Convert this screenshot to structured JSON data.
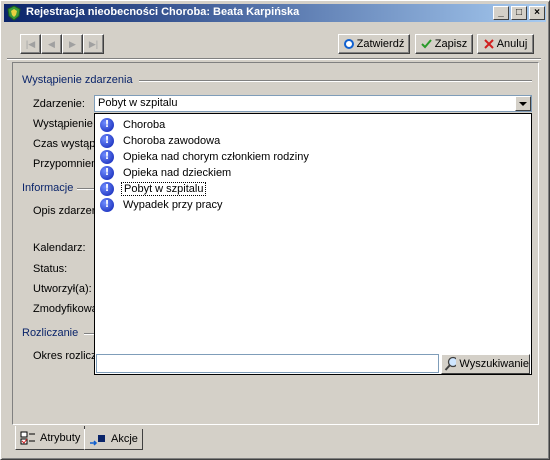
{
  "window": {
    "title": "Rejestracja nieobecności Choroba:  Beata Karpińska",
    "controls": [
      "_",
      "□",
      "×"
    ]
  },
  "toolbar": {
    "nav_icons": [
      "first-record-icon",
      "prev-record-icon",
      "next-record-icon",
      "last-record-icon"
    ],
    "confirm_label": "Zatwierdź",
    "save_label": "Zapisz",
    "cancel_label": "Anuluj"
  },
  "sections": {
    "occurrence": "Wystąpienie zdarzenia",
    "info": "Informacje",
    "settlement": "Rozliczanie"
  },
  "labels": {
    "event": "Zdarzenie:",
    "occurrence": "Wystąpienie",
    "time": "Czas wystąp",
    "reminder": "Przypomnien",
    "description": "Opis zdarzen",
    "calendar": "Kalendarz:",
    "status": "Status:",
    "created_by": "Utworzył(a):",
    "modified_by": "Zmodyfikowa",
    "period": "Okres rozlicz"
  },
  "event_select": {
    "value": "Pobyt w szpitalu",
    "options": [
      "Choroba",
      "Choroba zawodowa",
      "Opieka nad chorym członkiem rodziny",
      "Opieka nad dzieckiem",
      "Pobyt w szpitalu",
      "Wypadek przy pracy"
    ],
    "selected_index": 4,
    "search_value": "",
    "search_label": "Wyszukiwanie"
  },
  "tabs": {
    "attributes": "Atrybuty",
    "actions": "Akcje"
  }
}
